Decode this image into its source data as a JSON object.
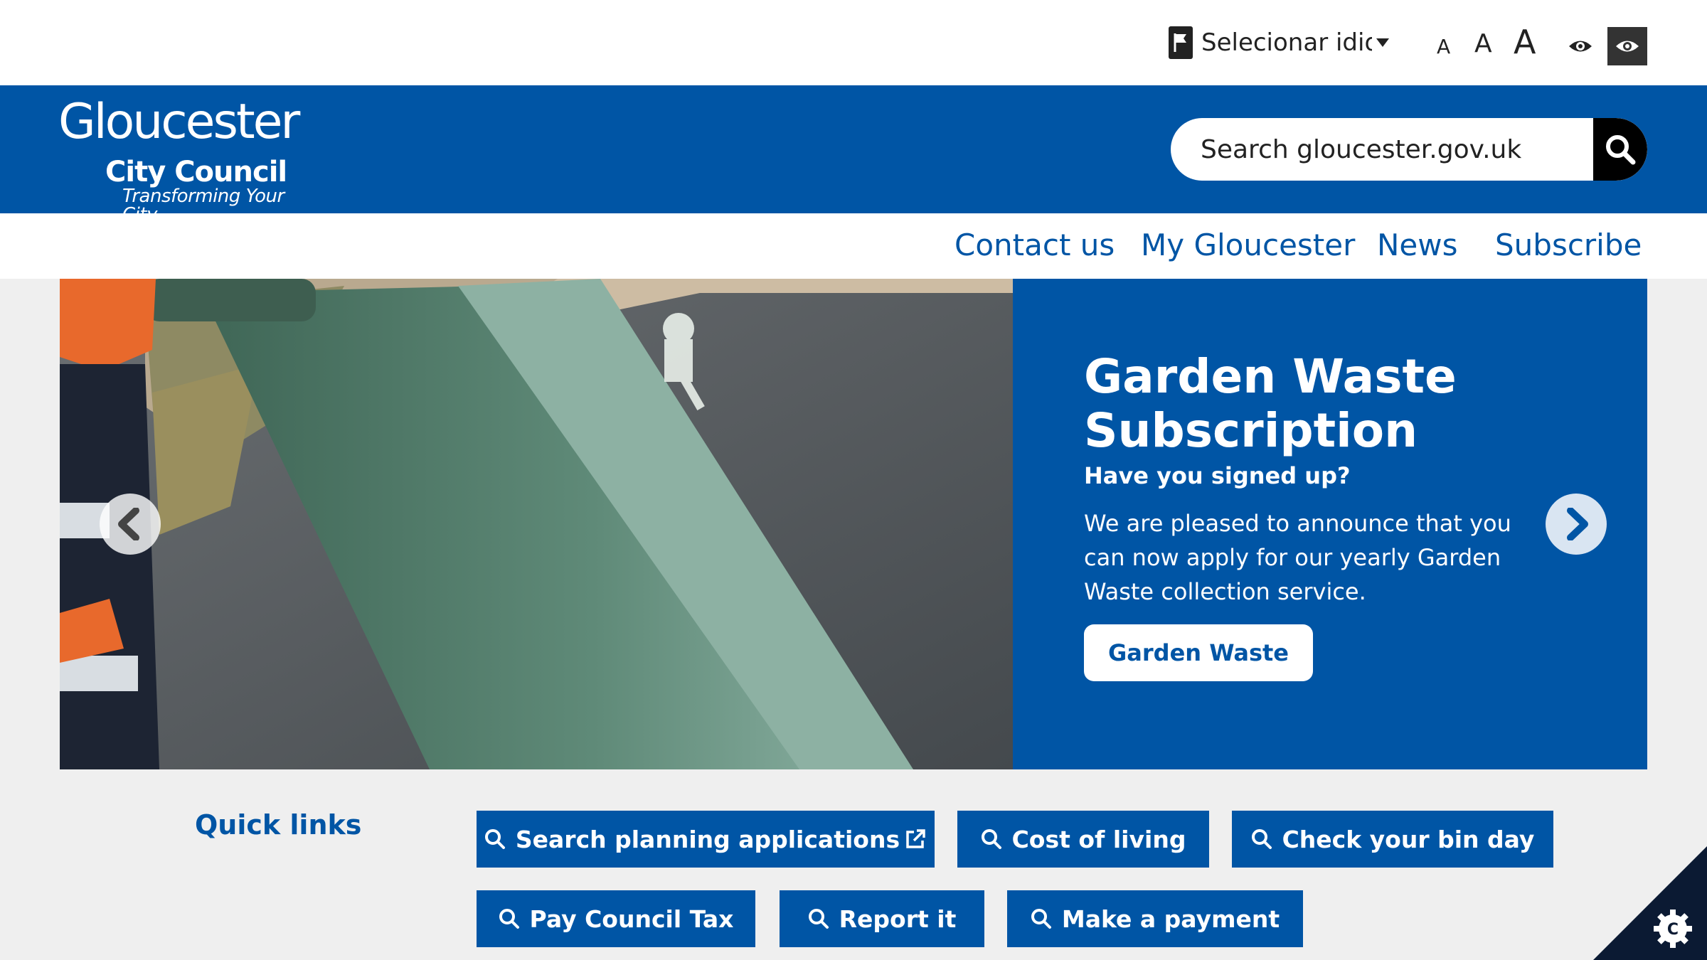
{
  "utility_bar": {
    "language_label": "Selecionar idioma",
    "text_size": {
      "small": "A",
      "medium": "A",
      "large": "A"
    }
  },
  "header": {
    "logo": {
      "line1": "Gloucester",
      "line2": "City Council",
      "tagline": "Transforming Your City"
    },
    "search": {
      "placeholder": "Search gloucester.gov.uk"
    }
  },
  "nav": {
    "items": [
      {
        "label": "Contact us"
      },
      {
        "label": "My Gloucester"
      },
      {
        "label": "News"
      },
      {
        "label": "Subscribe"
      }
    ]
  },
  "hero": {
    "title": "Garden Waste Subscription",
    "subtitle": "Have you signed up?",
    "body": "We are pleased to announce that you can now apply for our yearly Garden Waste collection service.",
    "button": "Garden Waste"
  },
  "quick_links": {
    "heading": "Quick links",
    "items": [
      {
        "label": "Search planning applications",
        "external": true
      },
      {
        "label": "Cost of living"
      },
      {
        "label": "Check your bin day"
      },
      {
        "label": "Pay Council Tax"
      },
      {
        "label": "Report it"
      },
      {
        "label": "Make a payment"
      }
    ]
  },
  "colors": {
    "brand_blue": "#0055a5",
    "white": "#ffffff",
    "page_bg": "#efefef",
    "dark": "#000000"
  },
  "icons": [
    "flag-icon",
    "caret-down-icon",
    "eye-icon",
    "search-icon",
    "chevron-left-icon",
    "chevron-right-icon",
    "external-link-icon",
    "cookie-settings-icon"
  ]
}
